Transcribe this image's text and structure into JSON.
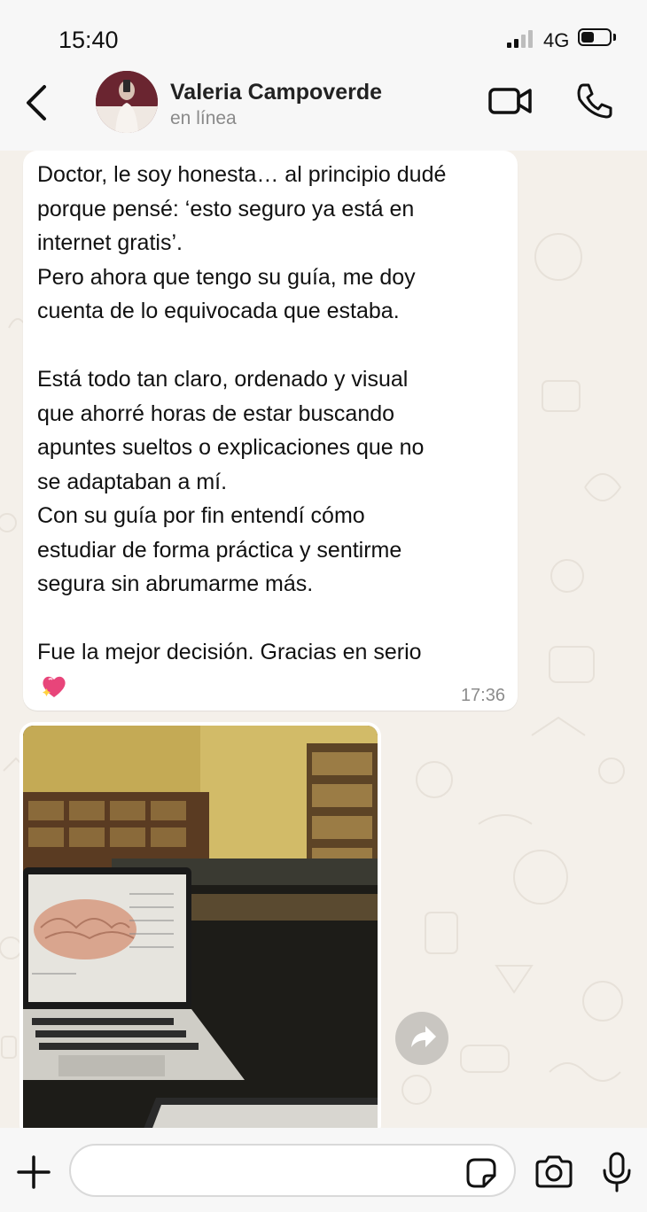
{
  "status_bar": {
    "time": "15:40",
    "network": "4G",
    "battery_level": 0.45
  },
  "header": {
    "contact_name": "Valeria Campoverde",
    "contact_status": "en línea"
  },
  "message": {
    "lines": [
      "Doctor, le soy honesta… al principio dudé",
      "porque pensé: ‘esto seguro ya está en",
      "internet gratis’.",
      "Pero ahora que tengo su guía, me doy",
      "cuenta de lo equivocada que estaba.",
      "",
      "Está todo tan claro, ordenado y visual",
      "que ahorré horas de estar buscando",
      "apuntes sueltos o explicaciones que no",
      "se adaptaban a mí.",
      "Con su guía por fin entendí cómo",
      "estudiar de forma práctica y sentirme",
      "segura sin abrumarme más.",
      "",
      "Fue la mejor decisión. Gracias en serio"
    ],
    "emoji": "sparkling-heart",
    "time": "17:36"
  },
  "image_message": {
    "description_icon": "photo-library-laptop-brain"
  },
  "composer": {
    "placeholder": ""
  },
  "colors": {
    "chat_background": "#f4f0ea",
    "bubble": "#ffffff",
    "bar_background": "#f7f7f7",
    "heart": "#e8457a"
  }
}
